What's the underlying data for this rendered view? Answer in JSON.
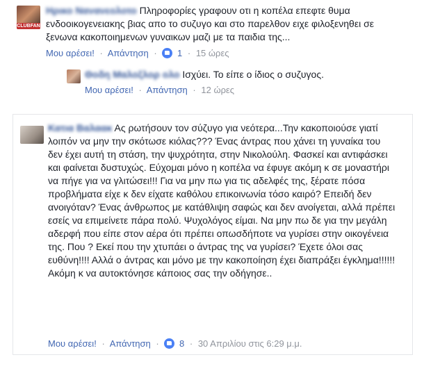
{
  "comment1": {
    "text": "Πληροφορίες γραφουν οτι η κοπέλα επεφτε θυμα ενδοοικογενειακης βιας απο το συζυγο και στο παρελθον ειχε φιλοξενηθει σε ξενωνα κακοποιημενων γυναικων μαζι με τα παιδια της...",
    "like_label": "Μου αρέσει!",
    "reply_label": "Απάντηση",
    "reaction_count": "1",
    "time": "15 ώρες",
    "avatar_tag": "CLUBFAN"
  },
  "reply1": {
    "text": "Ισχύει. Το είπε ο ίδιος ο συζυγος.",
    "like_label": "Μου αρέσει!",
    "reply_label": "Απάντηση",
    "time": "12 ώρες"
  },
  "comment2": {
    "text": "Ας ρωτήσουν τον σύζυγο για νεότερα...Την κακοποιούσε γιατί λοιπόν να μην την σκότωσε κιόλας??? Ένας άντρας που χάνει τη γυναίκα του δεν έχει αυτή τη στάση, την ψυχρότητα, στην Νικολούλη. Φασκεί και αντιφάσκει και φαίνεται δυστυχώς. Εύχομαι μόνο η κοπέλα να έφυγε ακόμη κ σε μοναστήρι να πήγε για να γλιτώσει!!! Για να μην πω για τις αδελφές της, ξέρατε πόσα προβλήματα είχε κ δεν είχατε καθόλου επικοινωνία τόσο καιρό? Επειδή δεν ανοιγόταν? Ένας άνθρωπος με κατάθλιψη σαφώς και δεν ανοίγεται, αλλά πρέπει εσείς να επιμείνετε πάρα πολύ. Ψυχολόγος είμαι. Να μην πω δε για την μεγάλη αδερφή που είπε στον αέρα ότι πρέπει οπωσδήποτε να γυρίσει στην οικογένεια της. Που ? Εκεί που την χτυπάει ο άντρας της να γυρίσει? Έχετε όλοι σας ευθύνη!!!! Αλλά ο άντρας και μόνο με την κακοποίηση έχει διαπράξει έγκλημα!!!!!! Ακόμη κ να αυτοκτόνησε κάποιος σας την οδήγησε..",
    "like_label": "Μου αρέσει!",
    "reply_label": "Απάντηση",
    "reaction_count": "8",
    "time": "30 Απριλίου στις 6:29 μ.μ."
  }
}
